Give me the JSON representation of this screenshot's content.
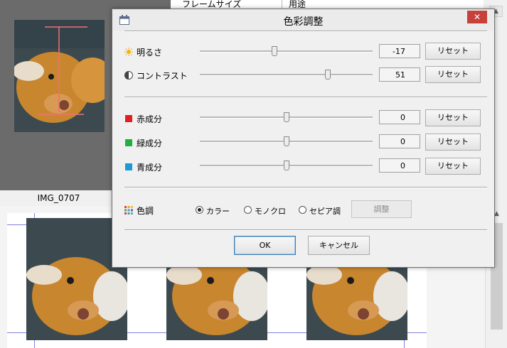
{
  "background": {
    "header_col1": "フレームサイズ",
    "header_col2": "用途",
    "image_label": "IMG_0707"
  },
  "dialog": {
    "title": "色彩調整",
    "close_label": "✕",
    "brightness": {
      "label": "明るさ",
      "value": "-17",
      "slider_level": 0.43,
      "reset": "リセット"
    },
    "contrast": {
      "label": "コントラスト",
      "value": "51",
      "slider_level": 0.75,
      "reset": "リセット"
    },
    "red": {
      "label": "赤成分",
      "value": "0",
      "slider_level": 0.5,
      "reset": "リセット",
      "color": "#e02020"
    },
    "green": {
      "label": "緑成分",
      "value": "0",
      "slider_level": 0.5,
      "reset": "リセット",
      "color": "#20b040"
    },
    "blue": {
      "label": "青成分",
      "value": "0",
      "slider_level": 0.5,
      "reset": "リセット",
      "color": "#1a9ad6"
    },
    "tone": {
      "label": "色調",
      "options": [
        "カラー",
        "モノクロ",
        "セピア調"
      ],
      "selected": "カラー",
      "adjust_button": "調整"
    },
    "ok_button": "OK",
    "cancel_button": "キャンセル"
  }
}
